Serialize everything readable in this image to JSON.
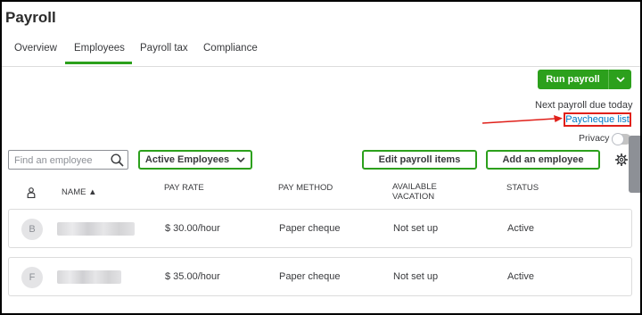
{
  "page": {
    "title": "Payroll"
  },
  "tabs": [
    {
      "label": "Overview"
    },
    {
      "label": "Employees"
    },
    {
      "label": "Payroll tax"
    },
    {
      "label": "Compliance"
    }
  ],
  "actions": {
    "run_payroll": "Run payroll",
    "next_due": "Next payroll due today",
    "paycheque_list": "Paycheque list",
    "privacy": "Privacy",
    "search_placeholder": "Find an employee",
    "filter": "Active Employees",
    "edit_items": "Edit payroll items",
    "add_employee": "Add an employee"
  },
  "table": {
    "headers": {
      "name": "NAME ▲",
      "pay_rate": "PAY RATE",
      "pay_method": "PAY METHOD",
      "vacation_line1": "AVAILABLE",
      "vacation_line2": "VACATION",
      "status": "STATUS"
    },
    "rows": [
      {
        "initial": "B",
        "pay_rate": "$ 30.00/hour",
        "pay_method": "Paper cheque",
        "vacation": "Not set up",
        "status": "Active"
      },
      {
        "initial": "F",
        "pay_rate": "$ 35.00/hour",
        "pay_method": "Paper cheque",
        "vacation": "Not set up",
        "status": "Active"
      }
    ]
  },
  "colors": {
    "brand_green": "#2ca01c",
    "link_blue": "#0077c5",
    "annotation_red": "#e0201a"
  }
}
